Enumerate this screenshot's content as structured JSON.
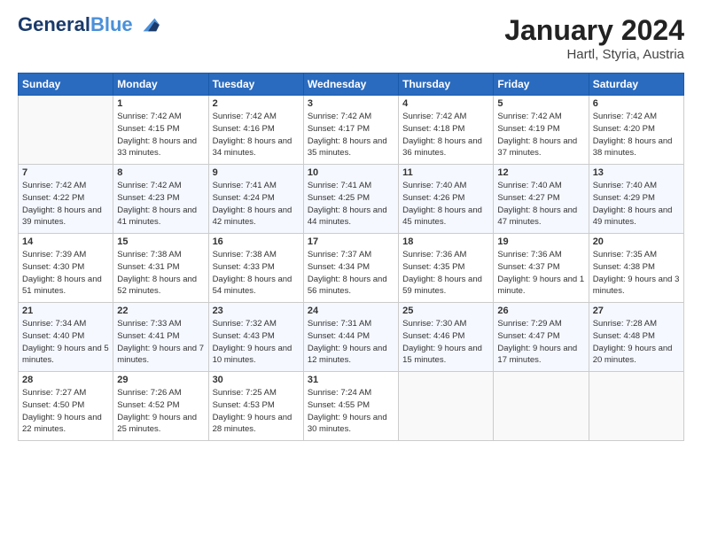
{
  "header": {
    "logo_line1": "General",
    "logo_line2": "Blue",
    "month": "January 2024",
    "location": "Hartl, Styria, Austria"
  },
  "weekdays": [
    "Sunday",
    "Monday",
    "Tuesday",
    "Wednesday",
    "Thursday",
    "Friday",
    "Saturday"
  ],
  "weeks": [
    [
      {
        "day": "",
        "sunrise": "",
        "sunset": "",
        "daylight": ""
      },
      {
        "day": "1",
        "sunrise": "Sunrise: 7:42 AM",
        "sunset": "Sunset: 4:15 PM",
        "daylight": "Daylight: 8 hours and 33 minutes."
      },
      {
        "day": "2",
        "sunrise": "Sunrise: 7:42 AM",
        "sunset": "Sunset: 4:16 PM",
        "daylight": "Daylight: 8 hours and 34 minutes."
      },
      {
        "day": "3",
        "sunrise": "Sunrise: 7:42 AM",
        "sunset": "Sunset: 4:17 PM",
        "daylight": "Daylight: 8 hours and 35 minutes."
      },
      {
        "day": "4",
        "sunrise": "Sunrise: 7:42 AM",
        "sunset": "Sunset: 4:18 PM",
        "daylight": "Daylight: 8 hours and 36 minutes."
      },
      {
        "day": "5",
        "sunrise": "Sunrise: 7:42 AM",
        "sunset": "Sunset: 4:19 PM",
        "daylight": "Daylight: 8 hours and 37 minutes."
      },
      {
        "day": "6",
        "sunrise": "Sunrise: 7:42 AM",
        "sunset": "Sunset: 4:20 PM",
        "daylight": "Daylight: 8 hours and 38 minutes."
      }
    ],
    [
      {
        "day": "7",
        "sunrise": "Sunrise: 7:42 AM",
        "sunset": "Sunset: 4:22 PM",
        "daylight": "Daylight: 8 hours and 39 minutes."
      },
      {
        "day": "8",
        "sunrise": "Sunrise: 7:42 AM",
        "sunset": "Sunset: 4:23 PM",
        "daylight": "Daylight: 8 hours and 41 minutes."
      },
      {
        "day": "9",
        "sunrise": "Sunrise: 7:41 AM",
        "sunset": "Sunset: 4:24 PM",
        "daylight": "Daylight: 8 hours and 42 minutes."
      },
      {
        "day": "10",
        "sunrise": "Sunrise: 7:41 AM",
        "sunset": "Sunset: 4:25 PM",
        "daylight": "Daylight: 8 hours and 44 minutes."
      },
      {
        "day": "11",
        "sunrise": "Sunrise: 7:40 AM",
        "sunset": "Sunset: 4:26 PM",
        "daylight": "Daylight: 8 hours and 45 minutes."
      },
      {
        "day": "12",
        "sunrise": "Sunrise: 7:40 AM",
        "sunset": "Sunset: 4:27 PM",
        "daylight": "Daylight: 8 hours and 47 minutes."
      },
      {
        "day": "13",
        "sunrise": "Sunrise: 7:40 AM",
        "sunset": "Sunset: 4:29 PM",
        "daylight": "Daylight: 8 hours and 49 minutes."
      }
    ],
    [
      {
        "day": "14",
        "sunrise": "Sunrise: 7:39 AM",
        "sunset": "Sunset: 4:30 PM",
        "daylight": "Daylight: 8 hours and 51 minutes."
      },
      {
        "day": "15",
        "sunrise": "Sunrise: 7:38 AM",
        "sunset": "Sunset: 4:31 PM",
        "daylight": "Daylight: 8 hours and 52 minutes."
      },
      {
        "day": "16",
        "sunrise": "Sunrise: 7:38 AM",
        "sunset": "Sunset: 4:33 PM",
        "daylight": "Daylight: 8 hours and 54 minutes."
      },
      {
        "day": "17",
        "sunrise": "Sunrise: 7:37 AM",
        "sunset": "Sunset: 4:34 PM",
        "daylight": "Daylight: 8 hours and 56 minutes."
      },
      {
        "day": "18",
        "sunrise": "Sunrise: 7:36 AM",
        "sunset": "Sunset: 4:35 PM",
        "daylight": "Daylight: 8 hours and 59 minutes."
      },
      {
        "day": "19",
        "sunrise": "Sunrise: 7:36 AM",
        "sunset": "Sunset: 4:37 PM",
        "daylight": "Daylight: 9 hours and 1 minute."
      },
      {
        "day": "20",
        "sunrise": "Sunrise: 7:35 AM",
        "sunset": "Sunset: 4:38 PM",
        "daylight": "Daylight: 9 hours and 3 minutes."
      }
    ],
    [
      {
        "day": "21",
        "sunrise": "Sunrise: 7:34 AM",
        "sunset": "Sunset: 4:40 PM",
        "daylight": "Daylight: 9 hours and 5 minutes."
      },
      {
        "day": "22",
        "sunrise": "Sunrise: 7:33 AM",
        "sunset": "Sunset: 4:41 PM",
        "daylight": "Daylight: 9 hours and 7 minutes."
      },
      {
        "day": "23",
        "sunrise": "Sunrise: 7:32 AM",
        "sunset": "Sunset: 4:43 PM",
        "daylight": "Daylight: 9 hours and 10 minutes."
      },
      {
        "day": "24",
        "sunrise": "Sunrise: 7:31 AM",
        "sunset": "Sunset: 4:44 PM",
        "daylight": "Daylight: 9 hours and 12 minutes."
      },
      {
        "day": "25",
        "sunrise": "Sunrise: 7:30 AM",
        "sunset": "Sunset: 4:46 PM",
        "daylight": "Daylight: 9 hours and 15 minutes."
      },
      {
        "day": "26",
        "sunrise": "Sunrise: 7:29 AM",
        "sunset": "Sunset: 4:47 PM",
        "daylight": "Daylight: 9 hours and 17 minutes."
      },
      {
        "day": "27",
        "sunrise": "Sunrise: 7:28 AM",
        "sunset": "Sunset: 4:48 PM",
        "daylight": "Daylight: 9 hours and 20 minutes."
      }
    ],
    [
      {
        "day": "28",
        "sunrise": "Sunrise: 7:27 AM",
        "sunset": "Sunset: 4:50 PM",
        "daylight": "Daylight: 9 hours and 22 minutes."
      },
      {
        "day": "29",
        "sunrise": "Sunrise: 7:26 AM",
        "sunset": "Sunset: 4:52 PM",
        "daylight": "Daylight: 9 hours and 25 minutes."
      },
      {
        "day": "30",
        "sunrise": "Sunrise: 7:25 AM",
        "sunset": "Sunset: 4:53 PM",
        "daylight": "Daylight: 9 hours and 28 minutes."
      },
      {
        "day": "31",
        "sunrise": "Sunrise: 7:24 AM",
        "sunset": "Sunset: 4:55 PM",
        "daylight": "Daylight: 9 hours and 30 minutes."
      },
      {
        "day": "",
        "sunrise": "",
        "sunset": "",
        "daylight": ""
      },
      {
        "day": "",
        "sunrise": "",
        "sunset": "",
        "daylight": ""
      },
      {
        "day": "",
        "sunrise": "",
        "sunset": "",
        "daylight": ""
      }
    ]
  ]
}
